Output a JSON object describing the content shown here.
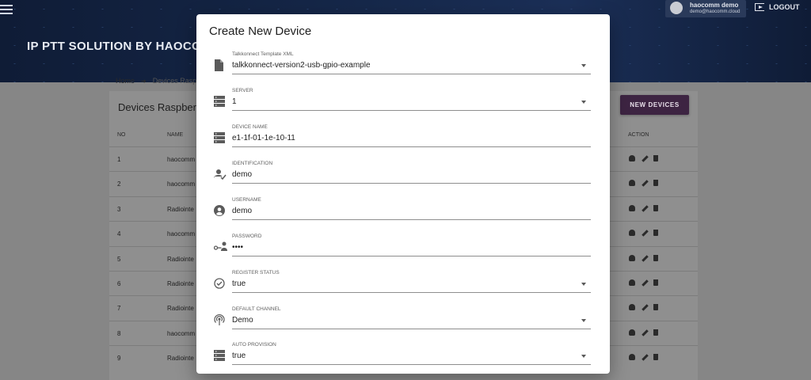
{
  "header": {
    "app_title": "IP PTT SOLUTION BY HAOCOMM",
    "user_name": "haocomm demo",
    "user_email": "demo@haocomm.cloud",
    "logout_label": "LOGOUT"
  },
  "breadcrumb": {
    "home": "Home",
    "current": "Devices Rasp"
  },
  "devices_card": {
    "title": "Devices Raspberr",
    "new_button_label": "NEW DEVICES",
    "columns": {
      "no": "NO",
      "name": "NAME",
      "action": "ACTION"
    },
    "rows": [
      {
        "no": "1",
        "name": "haocomm"
      },
      {
        "no": "2",
        "name": "haocomm"
      },
      {
        "no": "3",
        "name": "Radiointe"
      },
      {
        "no": "4",
        "name": "haocomm"
      },
      {
        "no": "5",
        "name": "Radiointe"
      },
      {
        "no": "6",
        "name": "Radiointe"
      },
      {
        "no": "7",
        "name": "Radiointe"
      },
      {
        "no": "8",
        "name": "haocomm"
      },
      {
        "no": "9",
        "name": "Radiointe"
      }
    ]
  },
  "modal": {
    "title": "Create New Device",
    "fields": [
      {
        "label": "Talkkonnect Template XML",
        "value": "talkkonnect-version2-usb-gpio-example",
        "type": "select",
        "icon": "file-icon"
      },
      {
        "label": "SERVER",
        "value": "1",
        "type": "select",
        "icon": "server-icon"
      },
      {
        "label": "DEVICE NAME",
        "value": "e1-1f-01-1e-10-11",
        "type": "text",
        "icon": "server-icon"
      },
      {
        "label": "IDENTIFICATION",
        "value": "demo",
        "type": "text",
        "icon": "person-check-icon"
      },
      {
        "label": "USERNAME",
        "value": "demo",
        "type": "text",
        "icon": "account-circle-icon"
      },
      {
        "label": "PASSWORD",
        "value": "••••",
        "type": "password",
        "icon": "key-person-icon"
      },
      {
        "label": "REGISTER STATUS",
        "value": "true",
        "type": "select",
        "icon": "check-circle-icon"
      },
      {
        "label": "DEFAULT CHANNEL",
        "value": "Demo",
        "type": "select",
        "icon": "broadcast-icon"
      },
      {
        "label": "AUTO PROVISION",
        "value": "true",
        "type": "select",
        "icon": "server-icon"
      }
    ]
  }
}
